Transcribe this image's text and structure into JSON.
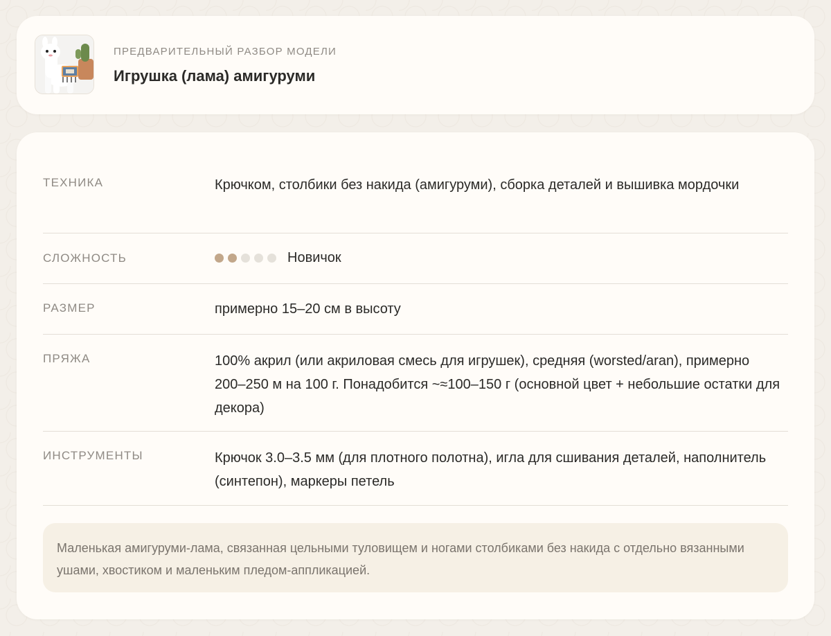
{
  "header": {
    "eyebrow": "ПРЕДВАРИТЕЛЬНЫЙ РАЗБОР МОДЕЛИ",
    "title": "Игрушка (лама) амигуруми",
    "thumbnail_icon": "llama-toy-photo"
  },
  "details": {
    "technique": {
      "label": "ТЕХНИКА",
      "value": "Крючком, столбики без накида (амигуруми), сборка деталей и вышивка мордочки"
    },
    "difficulty": {
      "label": "СЛОЖНОСТЬ",
      "value": "Новичок",
      "level": 2,
      "max_level": 5,
      "active_color": "#c2a78a",
      "inactive_color": "#e5e1da"
    },
    "size": {
      "label": "РАЗМЕР",
      "value": "примерно 15–20 см в высоту"
    },
    "yarn": {
      "label": "ПРЯЖА",
      "value": "100% акрил (или акриловая смесь для игрушек), средняя (worsted/aran), примерно 200–250 м на 100 г. Понадобится ~≈100–150 г (основной цвет + небольшие остатки для декора)"
    },
    "tools": {
      "label": "ИНСТРУМЕНТЫ",
      "value": "Крючок 3.0–3.5 мм (для плотного полотна), игла для сшивания деталей, наполнитель (синтепон), маркеры петель"
    }
  },
  "note": "Маленькая амигуруми-лама, связанная цельными туловищем и ногами столбиками без накида с отдельно вязанными ушами, хвостиком и маленьким пледом-аппликацией."
}
